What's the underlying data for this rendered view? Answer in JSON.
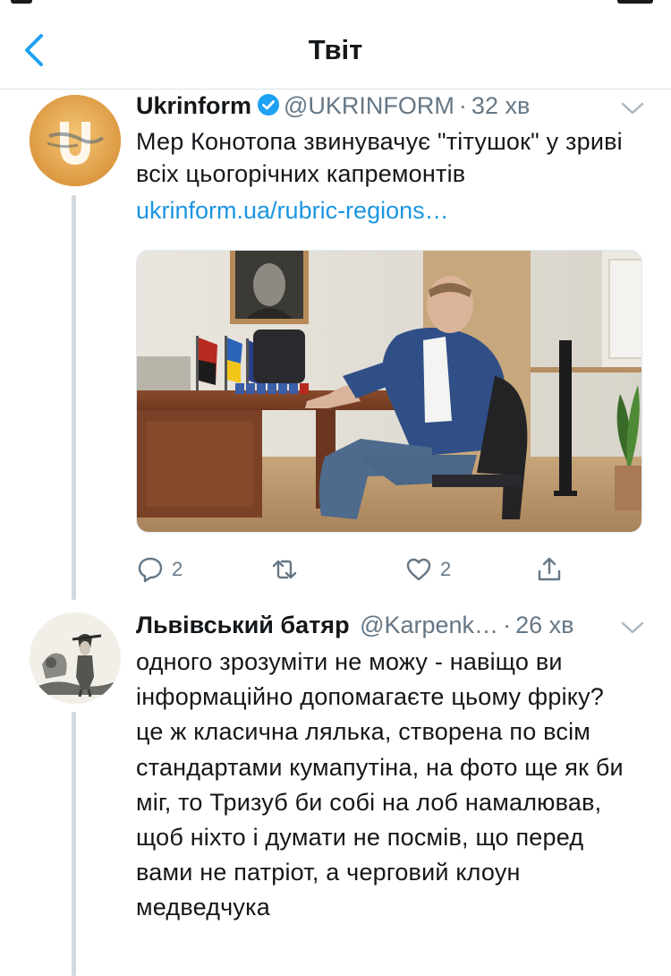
{
  "nav": {
    "title": "Твіт"
  },
  "tweet": {
    "author_name": "Ukrinform",
    "author_handle": "@UKRINFORM",
    "separator": "·",
    "time": "32 хв",
    "text": "Мер Конотопа звинувачує \"тітушок\" у зриві всіх цьогорічних капремонтів",
    "link": "ukrinform.ua/rubric-regions…",
    "replies": "2",
    "likes": "2",
    "avatar_icon": "ukrinform-logo-icon",
    "accent_color": "#1b95e0"
  },
  "reply": {
    "author_name": "Львівський батяр",
    "author_handle": "@Karpenk…",
    "separator": "·",
    "time": "26 хв",
    "text": "одного зрозуміти не можу - навіщо ви інформаційно допомагаєте цьому фріку? це ж класична лялька, створена по всім стандартами кумапутіна, на фото ще як би міг, то Тризуб би собі на лоб намалював, щоб ніхто і думати не посмів, що перед вами не патріот, а черговий клоун медведчука"
  }
}
